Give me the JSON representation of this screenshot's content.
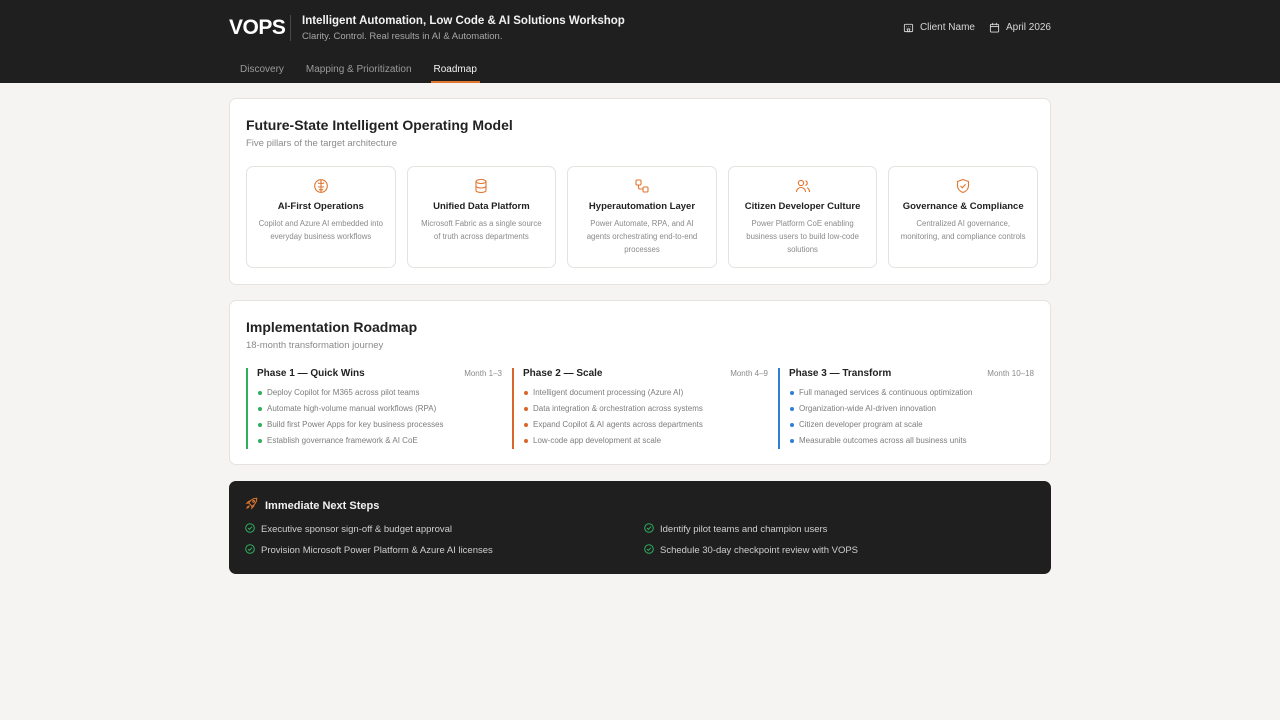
{
  "header": {
    "brand": "VOPS",
    "title": "Intelligent Automation, Low Code & AI Solutions Workshop",
    "subtitle": "Clarity. Control. Real results in AI & Automation.",
    "client": "Client Name",
    "date": "April 2026",
    "client_icon": "building-icon",
    "date_icon": "calendar-icon"
  },
  "tabs": [
    {
      "label": "Discovery",
      "active": false
    },
    {
      "label": "Mapping & Prioritization",
      "active": false
    },
    {
      "label": "Roadmap",
      "active": true
    }
  ],
  "colors": {
    "accent": "#e0762f",
    "phase1": "#2fae5f",
    "phase2": "#d9662a",
    "phase3": "#2f7fd6",
    "dark": "#1f1f1f"
  },
  "operating_model": {
    "title": "Future-State Intelligent Operating Model",
    "subtitle": "Five pillars of the target architecture",
    "pillars": [
      {
        "icon": "brain-icon",
        "title": "AI-First Operations",
        "desc": "Copilot and Azure AI embedded into everyday business workflows"
      },
      {
        "icon": "database-icon",
        "title": "Unified Data Platform",
        "desc": "Microsoft Fabric as a single source of truth across departments"
      },
      {
        "icon": "workflow-icon",
        "title": "Hyperautomation Layer",
        "desc": "Power Automate, RPA, and AI agents orchestrating end-to-end processes"
      },
      {
        "icon": "users-icon",
        "title": "Citizen Developer Culture",
        "desc": "Power Platform CoE enabling business users to build low-code solutions"
      },
      {
        "icon": "shield-check-icon",
        "title": "Governance & Compliance",
        "desc": "Centralized AI governance, monitoring, and compliance controls"
      }
    ]
  },
  "roadmap": {
    "title": "Implementation Roadmap",
    "subtitle": "18-month transformation journey",
    "phases": [
      {
        "name": "Phase 1 — Quick Wins",
        "months": "Month 1–3",
        "items": [
          "Deploy Copilot for M365 across pilot teams",
          "Automate high-volume manual workflows (RPA)",
          "Build first Power Apps for key business processes",
          "Establish governance framework & AI CoE"
        ]
      },
      {
        "name": "Phase 2 — Scale",
        "months": "Month 4–9",
        "items": [
          "Intelligent document processing (Azure AI)",
          "Data integration & orchestration across systems",
          "Expand Copilot & AI agents across departments",
          "Low-code app development at scale"
        ]
      },
      {
        "name": "Phase 3 — Transform",
        "months": "Month 10–18",
        "items": [
          "Full managed services & continuous optimization",
          "Organization-wide AI-driven innovation",
          "Citizen developer program at scale",
          "Measurable outcomes across all business units"
        ]
      }
    ]
  },
  "next_steps": {
    "title": "Immediate Next Steps",
    "icon": "rocket-icon",
    "items": [
      "Executive sponsor sign-off & budget approval",
      "Identify pilot teams and champion users",
      "Provision Microsoft Power Platform & Azure AI licenses",
      "Schedule 30-day checkpoint review with VOPS"
    ]
  }
}
